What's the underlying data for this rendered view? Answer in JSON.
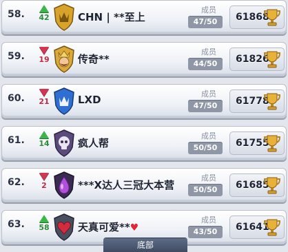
{
  "clans": [
    {
      "rank": "58.",
      "trend": "up",
      "change": "42",
      "name": "CHN | **至上",
      "heart": false,
      "members_label": "成员",
      "members": "47/50",
      "trophies": "61868",
      "badge_color": "#d8a32a",
      "badge_icon": "crown-icon"
    },
    {
      "rank": "59.",
      "trend": "down",
      "change": "19",
      "name": "传奇**",
      "heart": false,
      "members_label": "成员",
      "members": "44/50",
      "trophies": "61826",
      "badge_color": "#d9a93a",
      "badge_icon": "king-face-icon"
    },
    {
      "rank": "60.",
      "trend": "down",
      "change": "21",
      "name": "LXD",
      "heart": false,
      "members_label": "成员",
      "members": "47/50",
      "trophies": "61778",
      "badge_color": "#2f6fd1",
      "badge_icon": "crown-icon"
    },
    {
      "rank": "61.",
      "trend": "up",
      "change": "14",
      "name": "疯人帮",
      "heart": false,
      "members_label": "成员",
      "members": "50/50",
      "trophies": "61755",
      "badge_color": "#5b4a7c",
      "badge_icon": "skull-icon"
    },
    {
      "rank": "62.",
      "trend": "down",
      "change": "2",
      "name": "***X达人三冠大本营",
      "heart": false,
      "members_label": "成员",
      "members": "50/50",
      "trophies": "61685",
      "badge_color": "#3a2b52",
      "badge_icon": "elixir-drop-icon"
    },
    {
      "rank": "63.",
      "trend": "up",
      "change": "58",
      "name": "天真可爱**",
      "heart": true,
      "members_label": "成员",
      "members": "43/50",
      "trophies": "61641",
      "badge_color": "#4a4f60",
      "badge_icon": "heart-icon"
    }
  ],
  "bottom_tab": "底部",
  "colors": {
    "up": "#3bb54a",
    "down": "#d43553",
    "pill": "#8f97a6",
    "trophy": "#e8b23a"
  }
}
